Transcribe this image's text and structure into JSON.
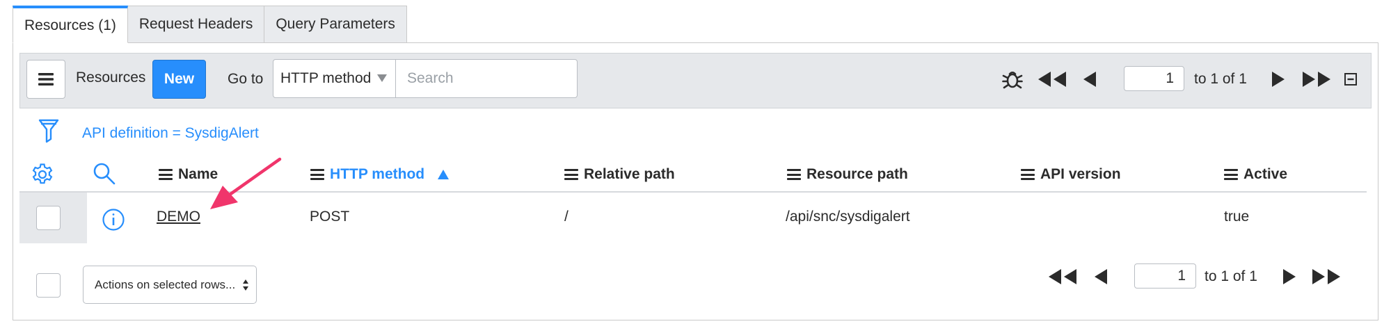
{
  "tabs": [
    {
      "label": "Resources (1)",
      "active": true
    },
    {
      "label": "Request Headers",
      "active": false
    },
    {
      "label": "Query Parameters",
      "active": false
    }
  ],
  "toolbar": {
    "list_title": "Resources",
    "new_label": "New",
    "goto_label": "Go to",
    "goto_field": "HTTP method",
    "search_placeholder": "Search",
    "page_value": "1",
    "page_summary": "to 1 of 1"
  },
  "filter": {
    "breadcrumb": "API definition = SysdigAlert"
  },
  "columns": [
    {
      "label": "Name",
      "sorted": false
    },
    {
      "label": "HTTP method",
      "sorted": true,
      "sort_direction": "ascending"
    },
    {
      "label": "Relative path",
      "sorted": false
    },
    {
      "label": "Resource path",
      "sorted": false
    },
    {
      "label": "API version",
      "sorted": false
    },
    {
      "label": "Active",
      "sorted": false
    }
  ],
  "rows": [
    {
      "name": "DEMO",
      "http_method": "POST",
      "relative_path": "/",
      "resource_path": "/api/snc/sysdigalert",
      "api_version": "",
      "active": "true"
    }
  ],
  "footer": {
    "actions_label": "Actions on selected rows...",
    "page_value": "1",
    "page_summary": "to 1 of 1"
  },
  "colors": {
    "accent": "#278efc",
    "toolbar_bg": "#e6e8eb",
    "annotation_arrow": "#f0356b"
  }
}
